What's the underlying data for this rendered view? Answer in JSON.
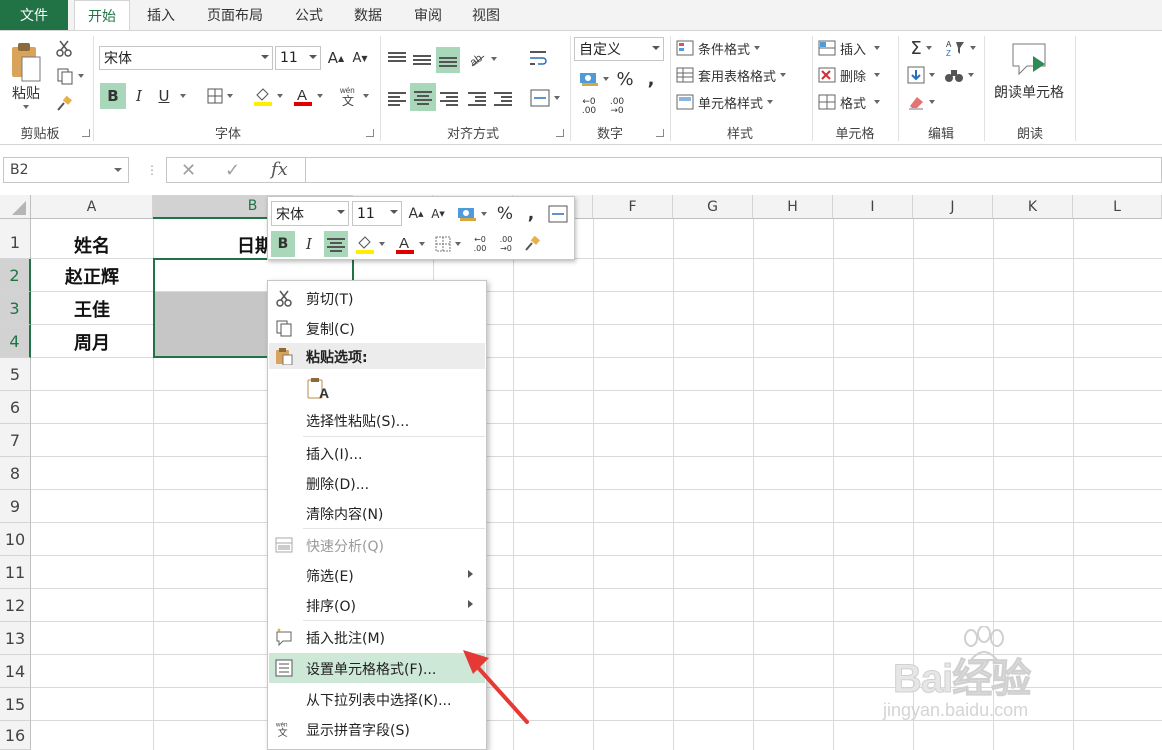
{
  "tabs": [
    "文件",
    "开始",
    "插入",
    "页面布局",
    "公式",
    "数据",
    "审阅",
    "视图"
  ],
  "active_tab": "开始",
  "ribbon": {
    "clipboard": {
      "paste": "粘贴",
      "label": "剪贴板"
    },
    "font": {
      "name": "宋体",
      "size": "11",
      "label": "字体",
      "bold": "B",
      "italic": "I",
      "underline": "U"
    },
    "alignment": {
      "label": "对齐方式"
    },
    "number": {
      "format": "自定义",
      "percent": "%",
      "comma": ",",
      "label": "数字",
      "inc_decimal": ".00",
      "dec_decimal": ".00"
    },
    "styles": {
      "conditional": "条件格式",
      "table": "套用表格格式",
      "cell": "单元格样式",
      "label": "样式"
    },
    "cells": {
      "insert": "插入",
      "delete": "删除",
      "format": "格式",
      "label": "单元格"
    },
    "editing": {
      "label": "编辑",
      "sigma": "Σ"
    },
    "read": {
      "button": "朗读单元格",
      "label": "朗读"
    }
  },
  "formula_bar": {
    "name_box": "B2",
    "fx": "fx",
    "cancel": "✕",
    "enter": "✓"
  },
  "columns": [
    "A",
    "B",
    "C",
    "D",
    "E",
    "F",
    "G",
    "H",
    "I",
    "J",
    "K",
    "L"
  ],
  "rows": [
    "1",
    "2",
    "3",
    "4",
    "5",
    "6",
    "7",
    "8",
    "9",
    "10",
    "11",
    "12",
    "13",
    "14",
    "15",
    "16"
  ],
  "cells": {
    "A1": "姓名",
    "B1": "日期",
    "A2": "赵正辉",
    "A3": "王佳",
    "A4": "周月"
  },
  "mini_toolbar": {
    "font": "宋体",
    "size": "11",
    "bold": "B",
    "italic": "I",
    "percent": "%",
    "comma": ","
  },
  "context_menu": [
    {
      "label": "剪切(T)",
      "icon": "scissors-icon"
    },
    {
      "label": "复制(C)",
      "icon": "copy-icon"
    },
    {
      "label": "粘贴选项:",
      "icon": "paste-icon",
      "header": true
    },
    {
      "label": "",
      "icon": "paste-format-icon",
      "paste_glyph": "A"
    },
    {
      "label": "选择性粘贴(S)..."
    },
    {
      "label": "插入(I)..."
    },
    {
      "label": "删除(D)..."
    },
    {
      "label": "清除内容(N)"
    },
    {
      "label": "快速分析(Q)",
      "icon": "quick-analysis-icon",
      "disabled": true
    },
    {
      "label": "筛选(E)",
      "submenu": true
    },
    {
      "label": "排序(O)",
      "submenu": true
    },
    {
      "label": "插入批注(M)",
      "icon": "comment-icon"
    },
    {
      "label": "设置单元格格式(F)...",
      "icon": "format-cells-icon",
      "highlighted": true
    },
    {
      "label": "从下拉列表中选择(K)..."
    },
    {
      "label": "显示拼音字段(S)",
      "icon": "phonetic-icon"
    }
  ],
  "watermark": {
    "text": "Bai经验",
    "url": "jingyan.baidu.com"
  },
  "colors": {
    "excel_green": "#217346",
    "highlight": "#a8d8b9",
    "menu_highlight": "#cde8d6",
    "arrow": "#e53935"
  }
}
